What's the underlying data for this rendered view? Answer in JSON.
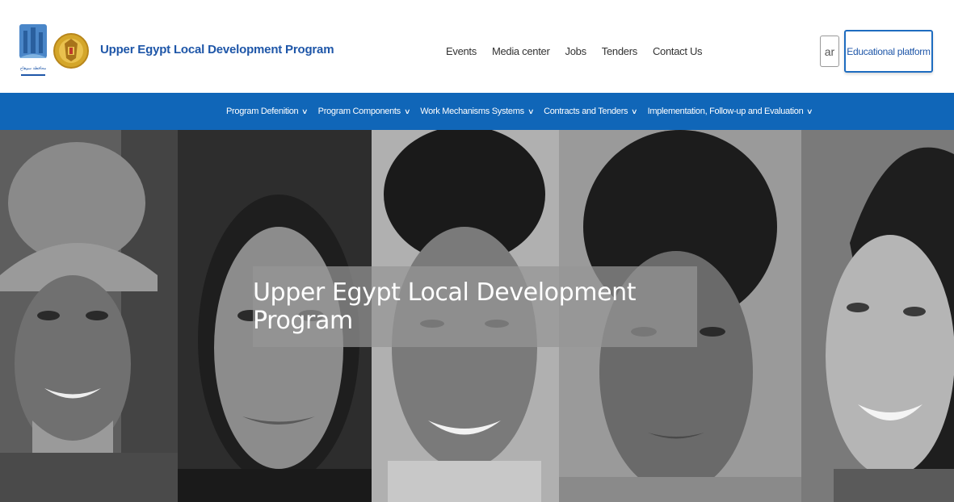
{
  "header": {
    "site_title": "Upper Egypt Local Development Program",
    "logo1_caption": "محافظة سوهاج",
    "nav": [
      "Events",
      "Media center",
      "Jobs",
      "Tenders",
      "Contact Us"
    ],
    "lang_label": "ar",
    "edu_button": "Educational platform"
  },
  "main_nav": {
    "items": [
      {
        "label": "Program Defenition"
      },
      {
        "label": "Program Components"
      },
      {
        "label": "Work Mechanisms Systems"
      },
      {
        "label": "Contracts and Tenders"
      },
      {
        "label": "Implementation, Follow-up and Evaluation"
      }
    ],
    "chevron": "∨"
  },
  "hero": {
    "title": "Upper Egypt Local Development Program"
  },
  "colors": {
    "brand_blue": "#1e56a8",
    "nav_bar": "#1066b8"
  }
}
